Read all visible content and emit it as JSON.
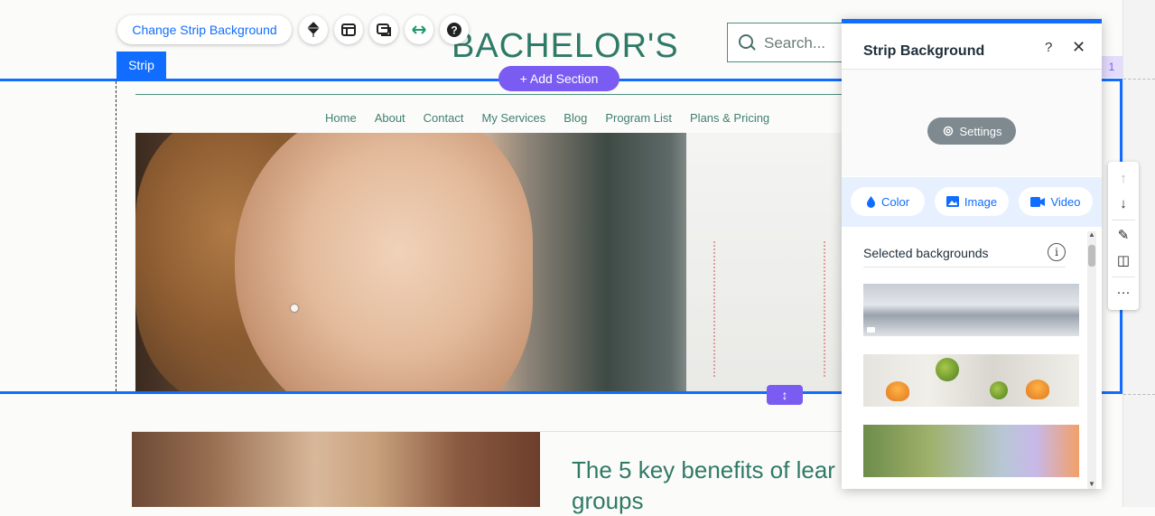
{
  "site": {
    "title": "BACHELOR'S",
    "search_placeholder": "Search...",
    "nav": [
      "Home",
      "About",
      "Contact",
      "My Services",
      "Blog",
      "Program List",
      "Plans & Pricing"
    ],
    "content_title": "The 5 key benefits of lear groups"
  },
  "editor": {
    "toolbar": {
      "change_bg_label": "Change Strip Background",
      "tools": [
        "layers-icon",
        "layout-icon",
        "animation-icon",
        "stretch-icon",
        "help-icon"
      ]
    },
    "strip_tag": "Strip",
    "add_section_label": "+ Add Section",
    "resize_glyph": "↕",
    "section_count": "1",
    "actions": [
      "↑",
      "↓",
      "✎",
      "◫",
      "···"
    ]
  },
  "panel": {
    "title": "Strip Background",
    "help": "?",
    "close": "✕",
    "settings_label": "Settings",
    "tabs": [
      {
        "label": "Color",
        "icon": "drop-icon"
      },
      {
        "label": "Image",
        "icon": "image-icon"
      },
      {
        "label": "Video",
        "icon": "video-icon"
      }
    ],
    "selected_label": "Selected backgrounds",
    "info": "i",
    "thumbnails": [
      "snowy-mountains-video",
      "citrus-fruits-image",
      "gradient-image"
    ]
  },
  "colors": {
    "accent": "#116dff",
    "section_purple": "#7b5cf2",
    "site_green": "#2f7a66"
  }
}
